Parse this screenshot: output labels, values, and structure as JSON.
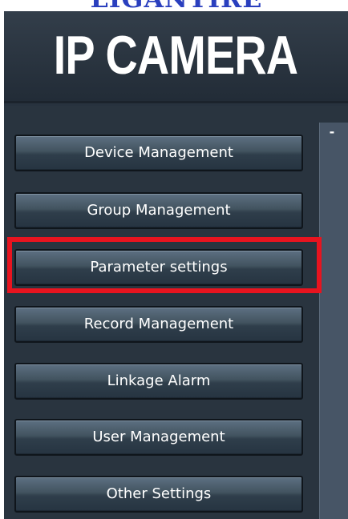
{
  "watermark_text": "LIGANTIRE",
  "header": {
    "title": "IP CAMERA"
  },
  "menu": {
    "items": [
      {
        "label": "Device Management"
      },
      {
        "label": "Group Management"
      },
      {
        "label": "Parameter settings",
        "highlighted": true
      },
      {
        "label": "Record Management"
      },
      {
        "label": "Linkage Alarm"
      },
      {
        "label": "User Management"
      },
      {
        "label": "Other Settings"
      }
    ]
  },
  "scrollbar": {
    "button_glyph": "-"
  },
  "colors": {
    "panel_bg": "#27323e",
    "button_top": "#5d7082",
    "button_bottom": "#263441",
    "highlight": "#e8141f",
    "watermark": "#2a3fbe"
  }
}
